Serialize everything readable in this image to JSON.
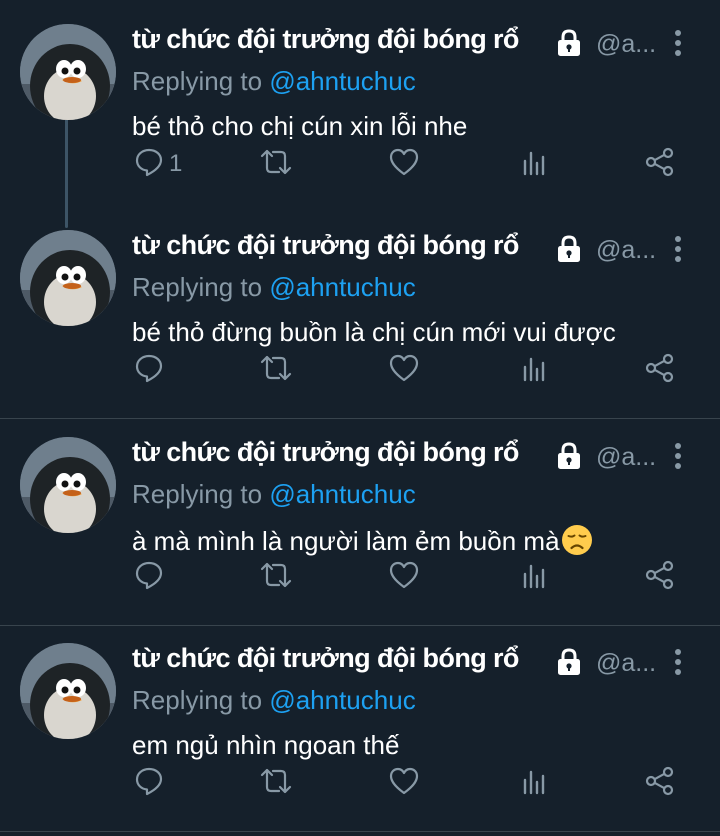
{
  "tweets": [
    {
      "author_name": "từ chức đội trưởng đội bóng rổ",
      "handle": "@a...",
      "reply_prefix": "Replying to",
      "reply_handle": "@ahntuchuc",
      "text": "bé thỏ cho chị cún xin lỗi nhe",
      "emoji": "",
      "reply_count": "1",
      "protected_icon": "lock-icon",
      "actions": [
        "reply-icon",
        "retweet-icon",
        "like-icon",
        "analytics-icon",
        "share-icon"
      ]
    },
    {
      "author_name": "từ chức đội trưởng đội bóng rổ",
      "handle": "@a...",
      "reply_prefix": "Replying to",
      "reply_handle": "@ahntuchuc",
      "text": "bé thỏ đừng buồn là chị cún mới vui được",
      "emoji": "",
      "reply_count": "",
      "protected_icon": "lock-icon",
      "actions": [
        "reply-icon",
        "retweet-icon",
        "like-icon",
        "analytics-icon",
        "share-icon"
      ]
    },
    {
      "author_name": "từ chức đội trưởng đội bóng rổ",
      "handle": "@a...",
      "reply_prefix": "Replying to",
      "reply_handle": "@ahntuchuc",
      "text": "à mà mình là người làm ẻm buồn mà",
      "emoji": "😞",
      "reply_count": "",
      "protected_icon": "lock-icon",
      "actions": [
        "reply-icon",
        "retweet-icon",
        "like-icon",
        "analytics-icon",
        "share-icon"
      ]
    },
    {
      "author_name": "từ chức đội trưởng đội bóng rổ",
      "handle": "@a...",
      "reply_prefix": "Replying to",
      "reply_handle": "@ahntuchuc",
      "text": "em ngủ nhìn ngoan thế",
      "emoji": "",
      "reply_count": "",
      "protected_icon": "lock-icon",
      "actions": [
        "reply-icon",
        "retweet-icon",
        "like-icon",
        "analytics-icon",
        "share-icon"
      ]
    }
  ],
  "colors": {
    "background": "#15202b",
    "divider": "#38444d",
    "secondary_text": "#8899a6",
    "link": "#1da1f2",
    "primary_text": "#ffffff"
  }
}
